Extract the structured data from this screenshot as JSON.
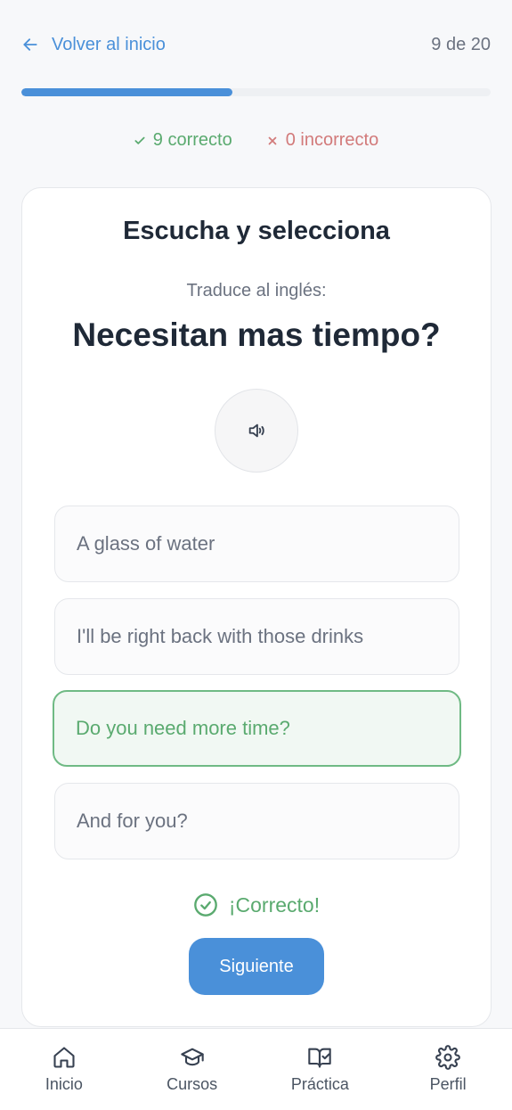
{
  "header": {
    "back_label": "Volver al inicio",
    "counter": "9 de 20",
    "progress_fraction": 0.45
  },
  "score": {
    "correct_label": "9 correcto",
    "incorrect_label": "0 incorrecto"
  },
  "card": {
    "title": "Escucha y selecciona",
    "instruction": "Traduce al inglés:",
    "prompt": "Necesitan mas tiempo?",
    "audio_icon": "speaker-icon",
    "options": [
      {
        "label": "A glass of water",
        "state": "default"
      },
      {
        "label": "I'll be right back with those drinks",
        "state": "default"
      },
      {
        "label": "Do you need more time?",
        "state": "correct"
      },
      {
        "label": "And for you?",
        "state": "default"
      }
    ],
    "feedback": "¡Correcto!",
    "next_label": "Siguiente"
  },
  "nav": {
    "items": [
      {
        "label": "Inicio",
        "icon": "home-icon"
      },
      {
        "label": "Cursos",
        "icon": "graduation-cap-icon"
      },
      {
        "label": "Práctica",
        "icon": "book-check-icon"
      },
      {
        "label": "Perfil",
        "icon": "gear-icon"
      }
    ]
  },
  "colors": {
    "accent": "#4a90d9",
    "success": "#5aaa6f",
    "error": "#d27a7a"
  }
}
